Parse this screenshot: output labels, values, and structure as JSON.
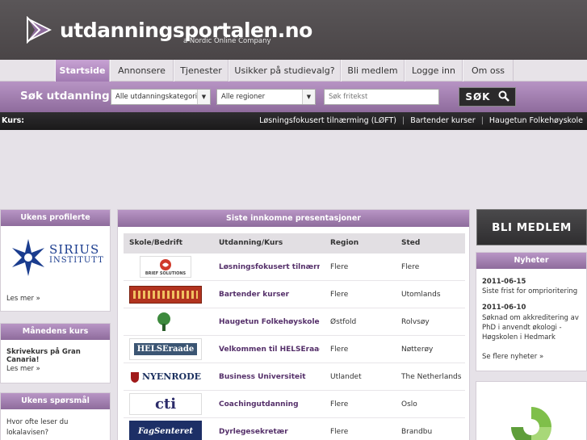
{
  "header": {
    "logo_text": "utdanningsportalen.no",
    "logo_sub": "a Nordic Online Company"
  },
  "nav": {
    "tabs": [
      {
        "label": "Startside",
        "active": true
      },
      {
        "label": "Annonsere",
        "active": false
      },
      {
        "label": "Tjenester",
        "active": false
      },
      {
        "label": "Usikker på studievalg?",
        "active": false
      },
      {
        "label": "Bli medlem",
        "active": false
      },
      {
        "label": "Logge inn",
        "active": false
      },
      {
        "label": "Om oss",
        "active": false
      }
    ]
  },
  "search": {
    "label": "Søk utdanning »",
    "category_value": "Alle utdanningskategorier",
    "region_value": "Alle regioner",
    "placeholder": "Søk fritekst",
    "button_label": "SØK"
  },
  "kurs_bar": {
    "label": "Kurs:",
    "links": [
      "Løsningsfokusert tilnærming (LØFT)",
      "Bartender kurser",
      "Haugetun Folkehøyskole"
    ]
  },
  "left": {
    "profiled": {
      "title": "Ukens profilerte",
      "logo_name": "SIRIUS",
      "logo_sub": "INSTITUTT",
      "more": "Les mer »"
    },
    "month_course": {
      "title": "Månedens kurs",
      "course": "Skrivekurs på Gran Canaria!",
      "more": "Les mer »"
    },
    "question": {
      "title": "Ukens spørsmål",
      "text": "Hvor ofte leser du lokalavisen?"
    }
  },
  "main": {
    "title": "Siste innkomne presentasjoner",
    "columns": [
      "Skole/Bedrift",
      "Utdanning/Kurs",
      "Region",
      "Sted"
    ],
    "rows": [
      {
        "logo": "BRIEF SOLUTIONS",
        "course": "Løsningsfokusert tilnærmi...",
        "region": "Flere",
        "sted": "Flere"
      },
      {
        "logo": "",
        "course": "Bartender kurser",
        "region": "Flere",
        "sted": "Utomlands"
      },
      {
        "logo": "",
        "course": "Haugetun Folkehøyskole",
        "region": "Østfold",
        "sted": "Rolvsøy"
      },
      {
        "logo": "HELSEraade",
        "course": "Velkommen til HELSEraade!",
        "region": "Flere",
        "sted": "Nøtterøy"
      },
      {
        "logo": "NYENRODE",
        "course": "Business Universiteit",
        "region": "Utlandet",
        "sted": "The Netherlands"
      },
      {
        "logo": "cti",
        "course": "Coachingutdanning",
        "region": "Flere",
        "sted": "Oslo"
      },
      {
        "logo": "FagSenteret",
        "course": "Dyrlegesekretær",
        "region": "Flere",
        "sted": "Brandbu"
      }
    ]
  },
  "right": {
    "bli_medlem": "BLI MEDLEM",
    "news": {
      "title": "Nyheter",
      "items": [
        {
          "date": "2011-06-15",
          "text": "Siste frist for omprioritering"
        },
        {
          "date": "2011-06-10",
          "text": "Søknad om akkreditering av PhD i anvendt økologi - Høgskolen i Hedmark"
        }
      ],
      "more": "Se flere nyheter »"
    }
  },
  "colors": {
    "purple": "#a27bb2",
    "dark": "#2b2a2b",
    "link": "#55306a"
  }
}
